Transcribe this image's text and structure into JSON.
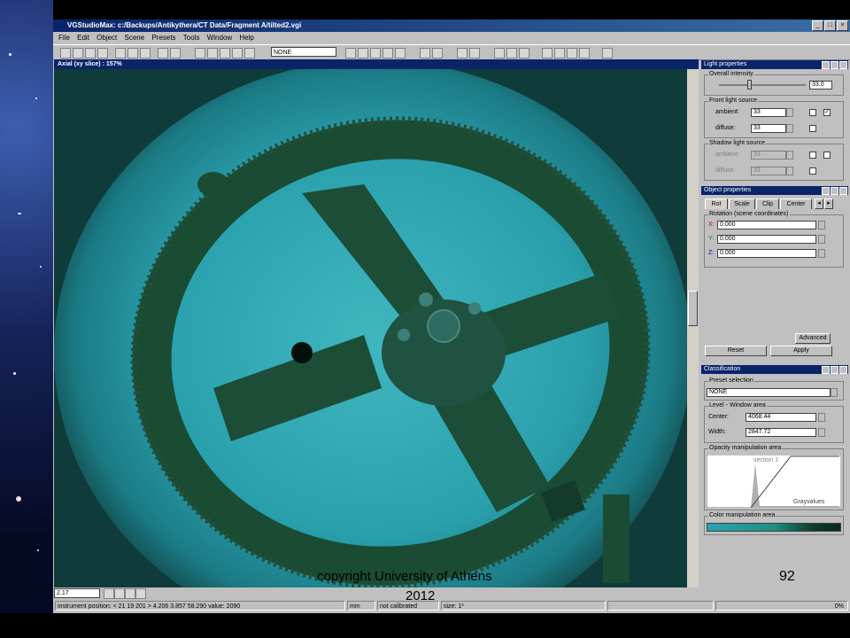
{
  "window": {
    "title": "VGStudioMax: c:/Backups/Antikythera/CT Data/Fragment A/tilted2.vgi"
  },
  "menu": [
    "File",
    "Edit",
    "Object",
    "Scene",
    "Presets",
    "Tools",
    "Window",
    "Help"
  ],
  "toolbar": {
    "preset_value": "NONE"
  },
  "view": {
    "title": "Axial (xy slice) : 157%",
    "zoom_value": "2.17"
  },
  "light_properties": {
    "title": "Light properties",
    "overall_intensity_label": "Overall intensity",
    "overall_intensity_value": "33.0",
    "overall_intensity_fraction": 0.33,
    "front_label": "Front light source",
    "ambient_label": "ambient:",
    "ambient_value": "33",
    "diffuse_label": "diffuse:",
    "diffuse_value": "33",
    "shadow_label": "Shadow light source",
    "shadow_ambient_label": "ambient:",
    "shadow_ambient_value": "33",
    "shadow_diffuse_label": "diffuse:",
    "shadow_diffuse_value": "33",
    "check_mark": "✓"
  },
  "object_properties": {
    "title": "Object properties",
    "tabs": [
      "Rot",
      "Scale",
      "Clip",
      "Center"
    ],
    "rotation_label": "Rotation (scene coordinates)",
    "x_label": "X:",
    "x_value": "0.000",
    "y_label": "Y:",
    "y_value": "0.000",
    "z_label": "Z:",
    "z_value": "0.000",
    "advanced": "Advanced",
    "reset": "Reset",
    "apply": "Apply"
  },
  "classification": {
    "title": "Classification",
    "preset_label": "Preset selection",
    "preset_value": "NONE",
    "level_label": "Level - Window area",
    "center_label": "Center:",
    "center_value": "4068.44",
    "width_label": "Width:",
    "width_value": "2847.72",
    "opacity_label": "Opacity manipulation area",
    "section_label": "section 1",
    "grayvalues_label": "Grayvalues",
    "color_label": "Color manipulation area"
  },
  "status": {
    "position": "instrument position: < 21 19 201 > 4.206 3.857 58.290 value: 2090",
    "unit": "mm",
    "calibration": "not calibrated",
    "size": "size: 1³",
    "percent": "0%"
  },
  "overlay": {
    "copyright_line1": "copyright University of Athens",
    "copyright_line2": "2012",
    "slide_number": "92"
  },
  "colors": {
    "title_blue": "#0a246a",
    "ct_dark": "#0f3b3a",
    "ct_cyan": "#2ba3b0"
  }
}
